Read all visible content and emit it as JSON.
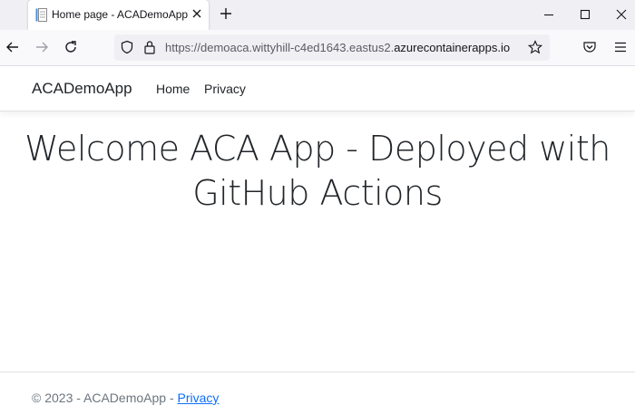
{
  "tab": {
    "title": "Home page - ACADemoApp",
    "favicon": "document-icon"
  },
  "window_controls": [
    "minimize",
    "maximize",
    "close"
  ],
  "toolbar": {
    "url_prefix": "https://demoaca.wittyhill-c4ed1643.eastus2.",
    "url_domain": "azurecontainerapps.io"
  },
  "site": {
    "brand": "ACADemoApp",
    "nav": [
      {
        "label": "Home"
      },
      {
        "label": "Privacy"
      }
    ]
  },
  "main": {
    "headline": "Welcome ACA App - Deployed with GitHub Actions"
  },
  "footer": {
    "copyright": "© 2023 - ACADemoApp - ",
    "link": "Privacy"
  },
  "colors": {
    "link": "#0d6efd",
    "text": "#212529",
    "muted": "#6c757d"
  }
}
